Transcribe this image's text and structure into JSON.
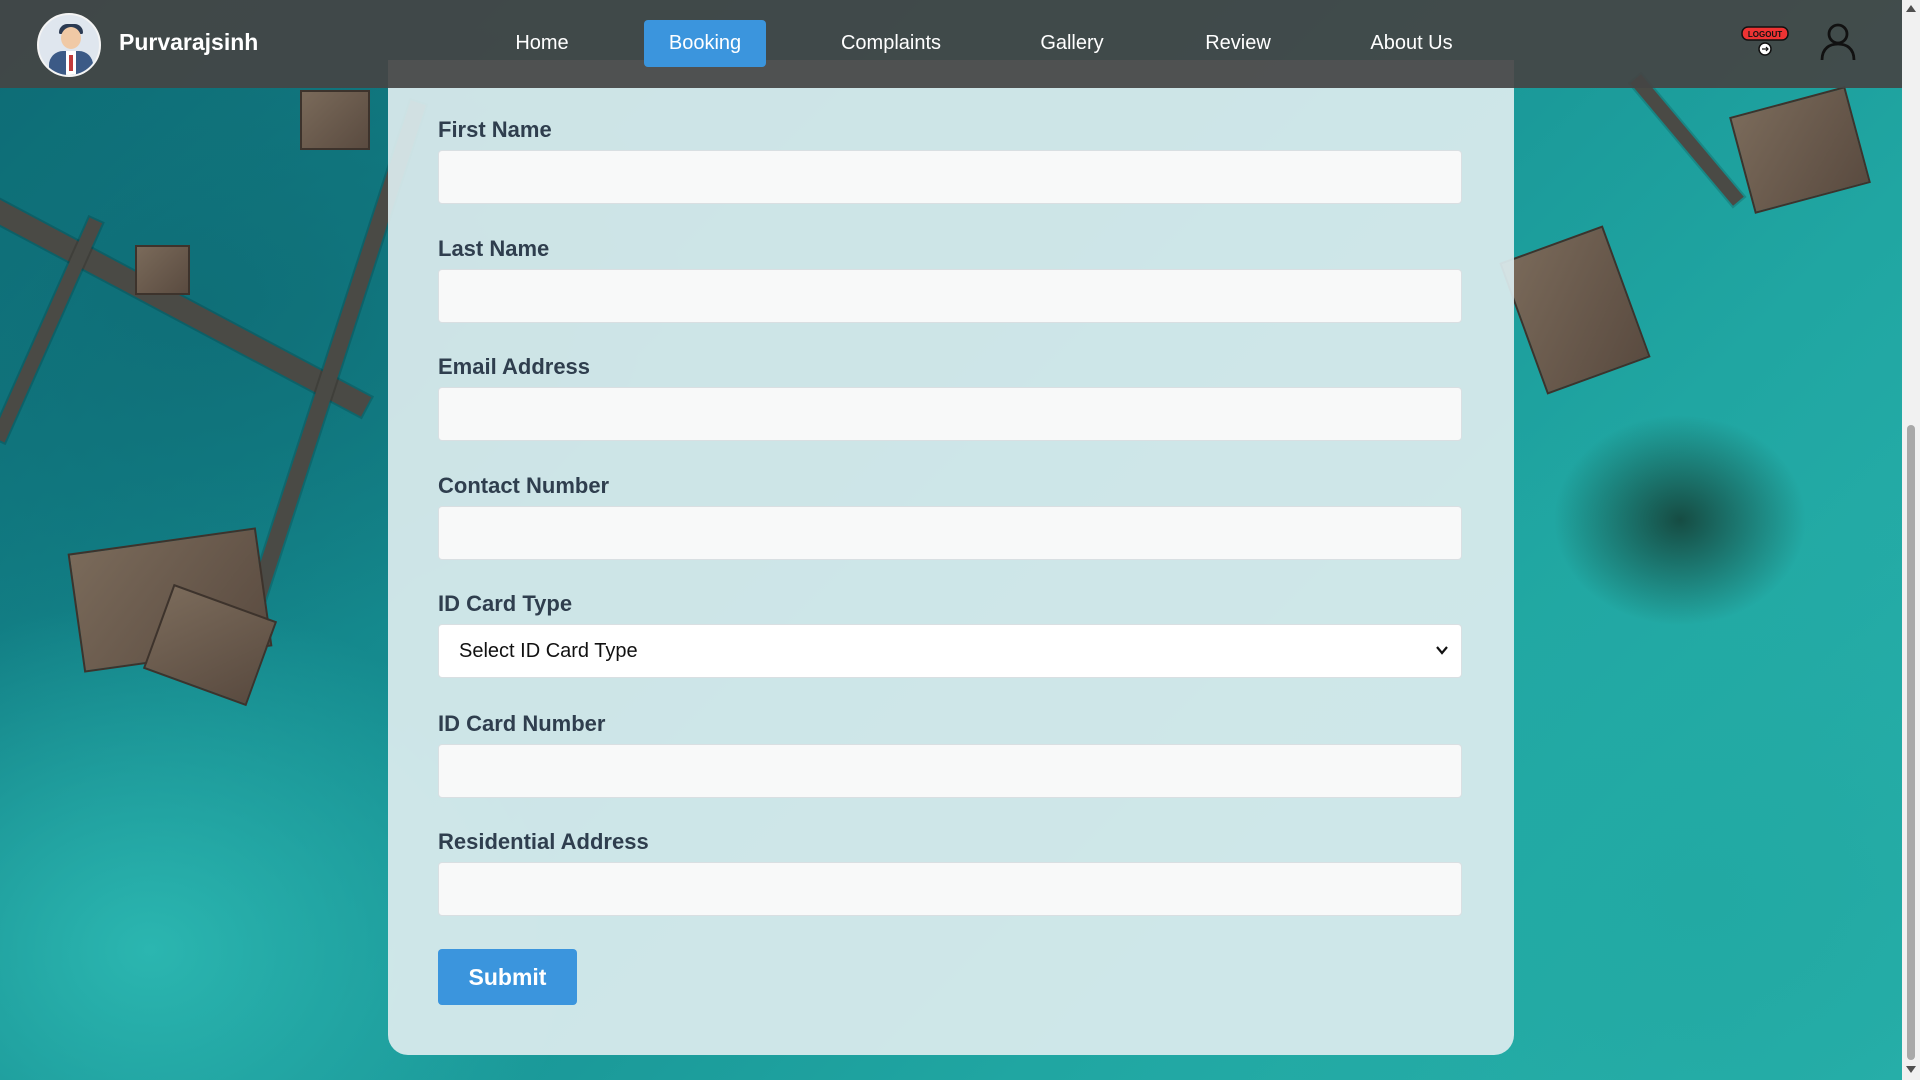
{
  "navbar": {
    "brand": "Purvarajsinh",
    "links": [
      {
        "label": "Home",
        "active": false
      },
      {
        "label": "Booking",
        "active": true
      },
      {
        "label": "Complaints",
        "active": false
      },
      {
        "label": "Gallery",
        "active": false
      },
      {
        "label": "Review",
        "active": false
      },
      {
        "label": "About Us",
        "active": false
      }
    ],
    "logout_icon_text": "LOGOUT",
    "icons": [
      "avatar-icon",
      "logout-icon",
      "user-icon"
    ]
  },
  "form": {
    "fields": [
      {
        "label": "First Name",
        "value": "",
        "type": "text"
      },
      {
        "label": "Last Name",
        "value": "",
        "type": "text"
      },
      {
        "label": "Email Address",
        "value": "",
        "type": "email"
      },
      {
        "label": "Contact Number",
        "value": "",
        "type": "tel"
      },
      {
        "label": "ID Card Type",
        "value": "Select ID Card Type",
        "type": "select"
      },
      {
        "label": "ID Card Number",
        "value": "",
        "type": "text"
      },
      {
        "label": "Residential Address",
        "value": "",
        "type": "text"
      }
    ],
    "submit_label": "Submit"
  },
  "colors": {
    "accent": "#3b95dd",
    "navbar": "#444444",
    "label": "#2f3e4e"
  }
}
